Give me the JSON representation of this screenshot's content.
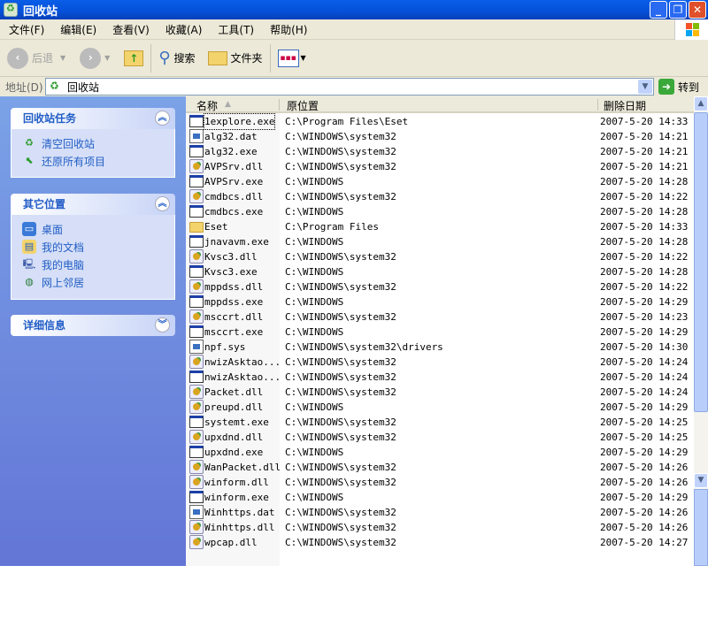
{
  "window": {
    "title": "回收站",
    "min": "_",
    "max": "❐",
    "close": "✕"
  },
  "menu": [
    "文件(F)",
    "编辑(E)",
    "查看(V)",
    "收藏(A)",
    "工具(T)",
    "帮助(H)"
  ],
  "toolbar": {
    "back": "后退",
    "search": "搜索",
    "folders": "文件夹"
  },
  "address": {
    "label": "地址(D)",
    "value": "回收站",
    "go": "转到"
  },
  "sidebar": {
    "tasks": {
      "title": "回收站任务",
      "items": [
        "清空回收站",
        "还原所有项目"
      ]
    },
    "places": {
      "title": "其它位置",
      "items": [
        "桌面",
        "我的文档",
        "我的电脑",
        "网上邻居"
      ]
    },
    "details": {
      "title": "详细信息"
    }
  },
  "columns": {
    "name": "名称",
    "location": "原位置",
    "date": "删除日期"
  },
  "files": [
    {
      "name": "1explore.exe",
      "type": "exe",
      "location": "C:\\Program Files\\Eset",
      "date": "2007-5-20 14:33"
    },
    {
      "name": "alg32.dat",
      "type": "dat",
      "location": "C:\\WINDOWS\\system32",
      "date": "2007-5-20 14:21"
    },
    {
      "name": "alg32.exe",
      "type": "exe",
      "location": "C:\\WINDOWS\\system32",
      "date": "2007-5-20 14:21"
    },
    {
      "name": "AVPSrv.dll",
      "type": "dll",
      "location": "C:\\WINDOWS\\system32",
      "date": "2007-5-20 14:21"
    },
    {
      "name": "AVPSrv.exe",
      "type": "exe",
      "location": "C:\\WINDOWS",
      "date": "2007-5-20 14:28"
    },
    {
      "name": "cmdbcs.dll",
      "type": "dll",
      "location": "C:\\WINDOWS\\system32",
      "date": "2007-5-20 14:22"
    },
    {
      "name": "cmdbcs.exe",
      "type": "exe",
      "location": "C:\\WINDOWS",
      "date": "2007-5-20 14:28"
    },
    {
      "name": "Eset",
      "type": "folder",
      "location": "C:\\Program Files",
      "date": "2007-5-20 14:33"
    },
    {
      "name": "jnavavm.exe",
      "type": "exe",
      "location": "C:\\WINDOWS",
      "date": "2007-5-20 14:28"
    },
    {
      "name": "Kvsc3.dll",
      "type": "dll",
      "location": "C:\\WINDOWS\\system32",
      "date": "2007-5-20 14:22"
    },
    {
      "name": "Kvsc3.exe",
      "type": "exe",
      "location": "C:\\WINDOWS",
      "date": "2007-5-20 14:28"
    },
    {
      "name": "mppdss.dll",
      "type": "dll",
      "location": "C:\\WINDOWS\\system32",
      "date": "2007-5-20 14:22"
    },
    {
      "name": "mppdss.exe",
      "type": "exe",
      "location": "C:\\WINDOWS",
      "date": "2007-5-20 14:29"
    },
    {
      "name": "msccrt.dll",
      "type": "dll",
      "location": "C:\\WINDOWS\\system32",
      "date": "2007-5-20 14:23"
    },
    {
      "name": "msccrt.exe",
      "type": "exe",
      "location": "C:\\WINDOWS",
      "date": "2007-5-20 14:29"
    },
    {
      "name": "npf.sys",
      "type": "dat",
      "location": "C:\\WINDOWS\\system32\\drivers",
      "date": "2007-5-20 14:30"
    },
    {
      "name": "nwizAsktao...",
      "type": "dll",
      "location": "C:\\WINDOWS\\system32",
      "date": "2007-5-20 14:24"
    },
    {
      "name": "nwizAsktao...",
      "type": "exe",
      "location": "C:\\WINDOWS\\system32",
      "date": "2007-5-20 14:24"
    },
    {
      "name": "Packet.dll",
      "type": "dll",
      "location": "C:\\WINDOWS\\system32",
      "date": "2007-5-20 14:24"
    },
    {
      "name": "preupd.dll",
      "type": "dll",
      "location": "C:\\WINDOWS",
      "date": "2007-5-20 14:29"
    },
    {
      "name": "systemt.exe",
      "type": "exe",
      "location": "C:\\WINDOWS\\system32",
      "date": "2007-5-20 14:25"
    },
    {
      "name": "upxdnd.dll",
      "type": "dll",
      "location": "C:\\WINDOWS\\system32",
      "date": "2007-5-20 14:25"
    },
    {
      "name": "upxdnd.exe",
      "type": "exe",
      "location": "C:\\WINDOWS",
      "date": "2007-5-20 14:29"
    },
    {
      "name": "WanPacket.dll",
      "type": "dll",
      "location": "C:\\WINDOWS\\system32",
      "date": "2007-5-20 14:26"
    },
    {
      "name": "winform.dll",
      "type": "dll",
      "location": "C:\\WINDOWS\\system32",
      "date": "2007-5-20 14:26"
    },
    {
      "name": "winform.exe",
      "type": "exe",
      "location": "C:\\WINDOWS",
      "date": "2007-5-20 14:29"
    },
    {
      "name": "Winhttps.dat",
      "type": "dat",
      "location": "C:\\WINDOWS\\system32",
      "date": "2007-5-20 14:26"
    },
    {
      "name": "Winhttps.dll",
      "type": "dll",
      "location": "C:\\WINDOWS\\system32",
      "date": "2007-5-20 14:26"
    },
    {
      "name": "wpcap.dll",
      "type": "dll",
      "location": "C:\\WINDOWS\\system32",
      "date": "2007-5-20 14:27"
    }
  ]
}
